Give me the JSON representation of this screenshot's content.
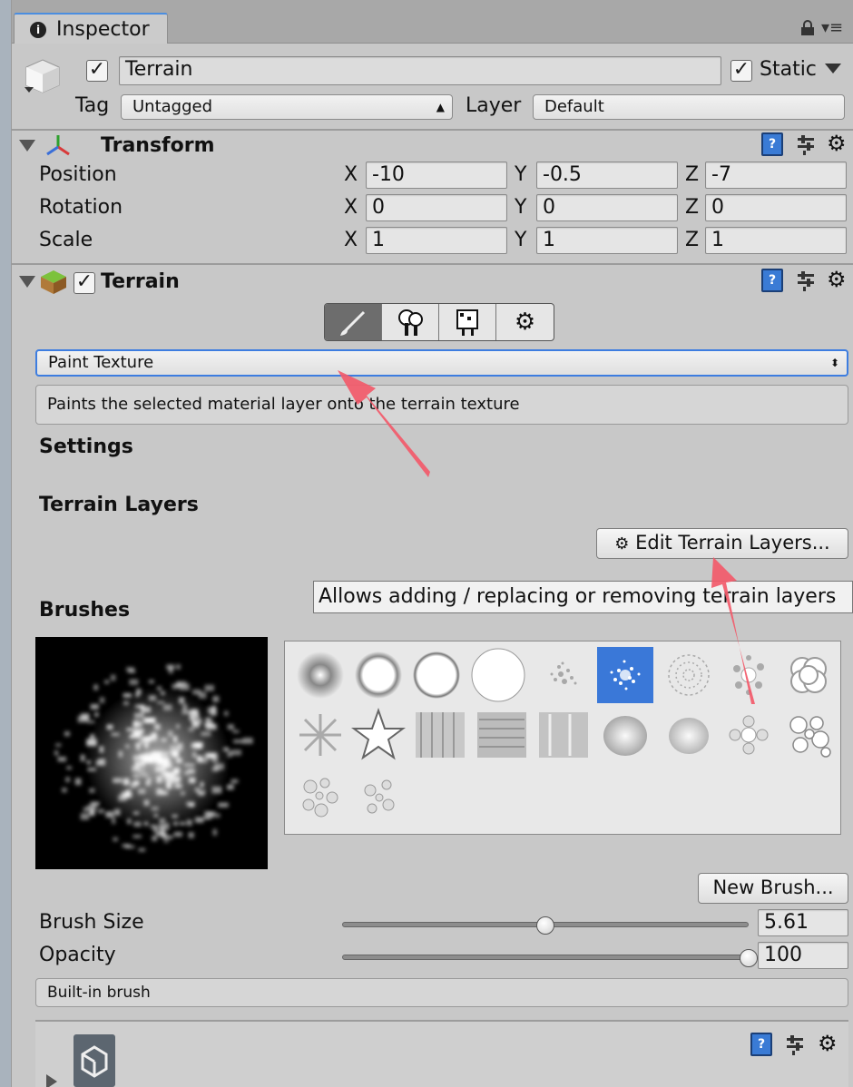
{
  "tab": {
    "label": "Inspector"
  },
  "object": {
    "name": "Terrain",
    "static_label": "Static",
    "tag_label": "Tag",
    "tag_value": "Untagged",
    "layer_label": "Layer",
    "layer_value": "Default"
  },
  "transform": {
    "title": "Transform",
    "rows": [
      {
        "label": "Position",
        "x": "-10",
        "y": "-0.5",
        "z": "-7"
      },
      {
        "label": "Rotation",
        "x": "0",
        "y": "0",
        "z": "0"
      },
      {
        "label": "Scale",
        "x": "1",
        "y": "1",
        "z": "1"
      }
    ],
    "axis": {
      "x": "X",
      "y": "Y",
      "z": "Z"
    }
  },
  "terrain": {
    "title": "Terrain",
    "mode_value": "Paint Texture",
    "description": "Paints the selected material layer onto the terrain texture",
    "settings_heading": "Settings",
    "layers_heading": "Terrain Layers",
    "edit_layers_button": "Edit Terrain Layers...",
    "tooltip": "Allows adding / replacing or removing terrain layers",
    "brushes_heading": "Brushes",
    "new_brush_button": "New Brush...",
    "brush_size_label": "Brush Size",
    "brush_size_value": "5.61",
    "brush_size_fraction": 0.5,
    "opacity_label": "Opacity",
    "opacity_value": "100",
    "opacity_fraction": 1.0,
    "brush_source": "Built-in brush"
  },
  "colors": {
    "accent": "#4b8ee0",
    "selected_brush": "#3a78d8",
    "annotation_arrow": "#f25a6a"
  }
}
